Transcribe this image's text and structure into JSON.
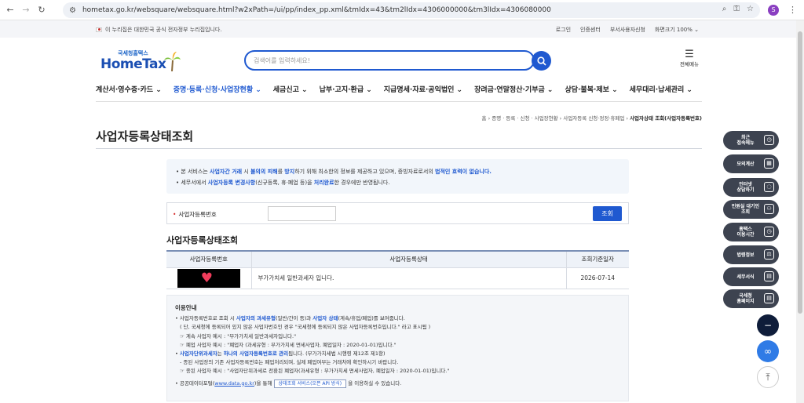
{
  "browser": {
    "url": "hometax.go.kr/websquare/websquare.html?w2xPath=/ui/pp/index_pp.xml&tmIdx=43&tm2lIdx=4306000000&tm3lIdx=4306080000",
    "profile_initial": "S"
  },
  "gov_banner": {
    "text": "이 누리집은 대한민국 공식 전자정부 누리집입니다.",
    "links": [
      "로그인",
      "인증센터",
      "부서사용자신청",
      "화면크기 100% ⌄"
    ]
  },
  "header": {
    "logo_kr": "국세청홈택스",
    "logo_en": "HomeTax",
    "search_placeholder": "검색어를 입력하세요!",
    "all_menu_label": "전체메뉴"
  },
  "gnb": [
    {
      "label": "계산서·영수증·카드 ⌄"
    },
    {
      "label": "증명·등록·신청·사업장현황 ⌄"
    },
    {
      "label": "세금신고 ⌄"
    },
    {
      "label": "납부·고지·환급 ⌄"
    },
    {
      "label": "지급명세·자료·공익법인 ⌄"
    },
    {
      "label": "장려금·연말정산·기부금 ⌄"
    },
    {
      "label": "상담·불복·제보 ⌄"
    },
    {
      "label": "세무대리·납세관리 ⌄"
    }
  ],
  "breadcrumb": {
    "path": "홈 › 증명 · 등록 · 신청 · 사업장현황 › 사업자등록 신청·정정·휴폐업 ›",
    "current": "사업자상태 조회(사업자등록번호)"
  },
  "page_title": "사업자등록상태조회",
  "notice": {
    "line1": [
      "• 본 서비스는 ",
      "사업자간 거래",
      " 시 ",
      "불의의 피해",
      "를 ",
      "방지",
      "하기 위해 최소한의 정보를 제공하고 있으며, 증빙자료로서의 ",
      "법적인 효력이 없습니다."
    ],
    "line2": [
      "• 세무서에서 ",
      "사업자등록 변경사항",
      "(신규등록, 휴·폐업 등)을 ",
      "처리완료",
      "한 경우에만 반영됩니다."
    ]
  },
  "form": {
    "label": "사업자등록번호",
    "required_mark": "•",
    "submit": "조회"
  },
  "section_title": "사업자등록상태조회",
  "table": {
    "headers": [
      "사업자등록번호",
      "사업자등록상태",
      "조회기준일자"
    ],
    "rows": [
      {
        "reg_no_redaction": "♥",
        "status": "부가가치세 일반과세자 입니다.",
        "date": "2026-07-14"
      }
    ]
  },
  "guide": {
    "title": "이용안내",
    "l1a": "• 사업자등록번호로 조회 시 ",
    "l1b": "사업자의 과세유형",
    "l1c": "(일반/간이 등)과 ",
    "l1d": "사업자 상태",
    "l1e": "(계속/휴업/폐업)를 보여줍니다.",
    "l2": "( 단, 국세청에 등록되어 있지 않은 사업자번호인 경우 \"국세청에 등록되지 않은 사업자등록번호입니다.\" 라고 표시됨 )",
    "l3": "☞ 계속 사업자 예시 : \"부가가치세 일반과세자입니다.\"",
    "l4": "☞ 폐업 사업자 예시 : \"폐업자 (과세유형 : 부가가치세 면세사업자, 폐업일자 : 2020-01-01)입니다.\"",
    "l5a": "• ",
    "l5b": "사업자단위과세자",
    "l5c": "는 ",
    "l5d": "하나의 사업자등록번호로 관리",
    "l5e": "됩니다. (부가가치세법 시행령 제12조 제1항)",
    "l6": "- 종된 사업장의 기존 사업자등록번호는 폐업처리되며, 실제 폐업여부는 거래처에 확인하시기 바랍니다.",
    "l7": "☞ 종된 사업자 예시 : \"사업자단위과세로 전환된 폐업자(과세유형 : 부가가치세 면세사업자, 폐업일자 : 2020-01-01)입니다.\"",
    "l8a": "• 공공데이터포털(",
    "l8b": "www.data.go.kr",
    "l8c": ")을 통해 ",
    "l8d": "상태조회 서비스(오픈 API 방식)",
    "l8e": " 을 이용하실 수 있습니다."
  },
  "quick_menu": [
    {
      "label": "최근\n접속메뉴",
      "icon": "clock-icon"
    },
    {
      "label": "모의계산",
      "icon": "calculator-icon"
    },
    {
      "label": "인터넷\n상담하기",
      "icon": "chat-icon"
    },
    {
      "label": "민원실 대기인\n조회",
      "icon": "people-icon"
    },
    {
      "label": "홈택스\n이용시간",
      "icon": "clock-icon"
    },
    {
      "label": "법령정보",
      "icon": "scale-icon"
    },
    {
      "label": "세무서식",
      "icon": "document-icon"
    },
    {
      "label": "국세청\n홈페이지",
      "icon": "document-icon"
    }
  ],
  "colors": {
    "accent": "#1f59d0",
    "quick_menu_bg": "#3d4350"
  }
}
